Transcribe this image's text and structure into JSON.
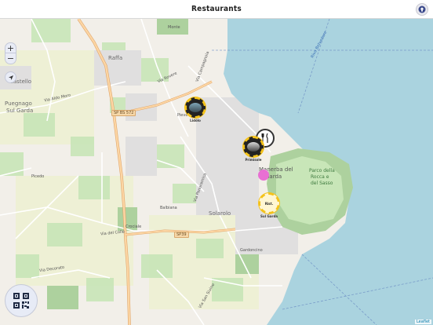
{
  "header": {
    "title": "Restaurants",
    "up_button_icon": "arrow-up-icon"
  },
  "map": {
    "attribution": "Leaflet",
    "zoom_in": "+",
    "zoom_out": "−",
    "labels": {
      "raffa": "Raffa",
      "castello": "Castello",
      "puegnago": "Puegnago",
      "sul_garda": "Sul Garda",
      "monte_croce": "Monte",
      "balbiana": "Balbiana",
      "solarolo": "Solarolo",
      "gardoncino": "Gardoncino",
      "picedo": "Picedo",
      "manerba": "Manerba del",
      "manerba2": "Garda",
      "parco": "Parco della",
      "parco2": "Rocca e",
      "parco3": "del Sasso",
      "pieve": "Pieve",
      "via_aldo_moro": "Via Aldo Moro",
      "via_del_colle": "Via del Colle",
      "via_rovere": "Via Rovere",
      "crociale": "Crociale",
      "via_panoramica": "Via Panoramica",
      "via_campagnola": "Via Campagnola",
      "via_san_sivino": "Via San Sivino",
      "via_decorato": "Via Decorato",
      "water": "Riva Belvedere"
    },
    "shields": {
      "sp_bs_572": "SP BS 572",
      "sp39": "SP39"
    },
    "markers": [
      {
        "name": "restaurant-photo",
        "caption": "Lidòlo"
      },
      {
        "name": "restaurant-fork",
        "caption": ""
      },
      {
        "name": "restaurant-photo-2",
        "caption": "Primisole"
      },
      {
        "name": "restaurant-sul-garda",
        "caption": "Sul Garda",
        "inner": "Ristorante Sul Garda"
      }
    ]
  },
  "qr_button": {
    "icon": "qr-code-icon"
  },
  "colors": {
    "water": "#aad3df",
    "land": "#f2efe9",
    "farmland": "#eef0d5",
    "vineyard": "#aedfa3",
    "forest": "#add19e",
    "residential": "#e0dfdf",
    "road_major": "#fcd6a4",
    "marker_ring": "#f4c21a"
  }
}
